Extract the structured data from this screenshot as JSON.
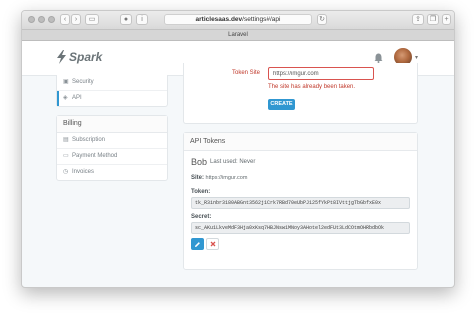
{
  "browser": {
    "url_host": "articlesaas.dev",
    "url_path": "/settings#/api",
    "tab_title": "Laravel"
  },
  "navbar": {
    "brand": "Spark",
    "accent": "#3097d1"
  },
  "sidebar": {
    "settings_items": [
      {
        "label": "Security",
        "icon": "lock-icon"
      },
      {
        "label": "API",
        "icon": "cubes-icon",
        "active": true
      }
    ],
    "billing_heading": "Billing",
    "billing_items": [
      {
        "label": "Subscription",
        "icon": "shopping-bag-icon"
      },
      {
        "label": "Payment Method",
        "icon": "credit-card-icon"
      },
      {
        "label": "Invoices",
        "icon": "history-icon"
      }
    ]
  },
  "create_token": {
    "token_site_label": "Token Site",
    "token_site_value": "https://imgur.com",
    "error": "The site has already been taken.",
    "create_button": "CREATE"
  },
  "api_tokens": {
    "heading": "API Tokens",
    "token_name": "Bob",
    "last_used": "Last used: Never",
    "site_label": "Site:",
    "site_value": "https://imgur.com",
    "token_label": "Token:",
    "token_value": "tk_R3inbr3180ABGnt3562j1Crk7RBd70eUbPJ125fYkPt8IVttjgTbGbfxE0x",
    "secret_label": "Secret:",
    "secret_value": "sc_AKu1LkveMdF3Hja0xKsq7HBJNsw1MNoy3AHotel2edFUt3LdCOtmOHRbdbOk",
    "edit_icon": "pencil-icon",
    "delete_icon": "close-icon"
  }
}
